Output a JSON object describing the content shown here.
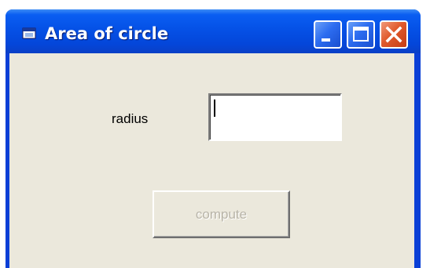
{
  "window": {
    "title": "Area of circle",
    "app_icon": "window-app-icon",
    "controls": {
      "minimize_icon": "minimize-icon",
      "maximize_icon": "maximize-icon",
      "close_icon": "close-icon"
    }
  },
  "form": {
    "radius_label": "radius",
    "radius_value": "",
    "compute_label": "compute",
    "compute_enabled": false
  },
  "colors": {
    "titlebar": "#0551e6",
    "client_background": "#ebe8dc",
    "close_button": "#e05a2c",
    "disabled_text": "#b8b4a8"
  }
}
